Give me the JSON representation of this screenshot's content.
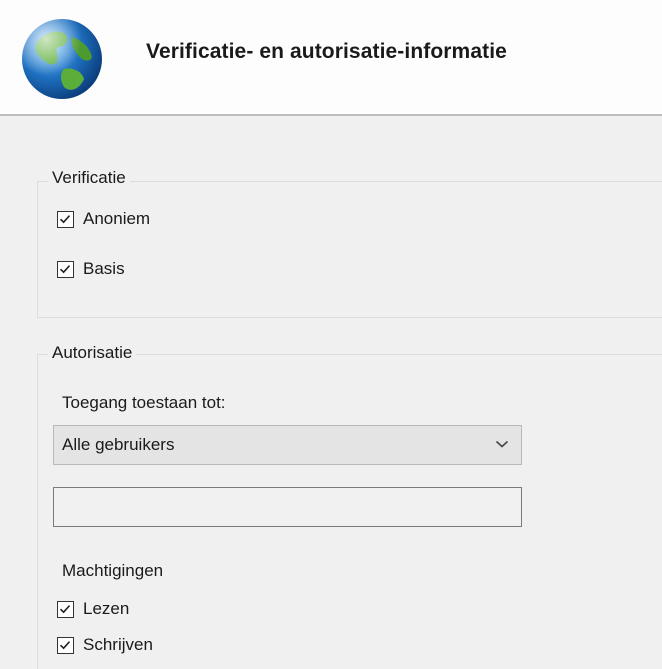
{
  "header": {
    "title": "Verificatie- en autorisatie-informatie",
    "icon": "globe-icon"
  },
  "verificatie": {
    "legend": "Verificatie",
    "options": [
      {
        "label": "Anoniem",
        "checked": true
      },
      {
        "label": "Basis",
        "checked": true
      }
    ]
  },
  "autorisatie": {
    "legend": "Autorisatie",
    "access_label": "Toegang toestaan tot:",
    "access_select": {
      "selected": "Alle gebruikers"
    },
    "access_input": {
      "value": ""
    },
    "permissions_label": "Machtigingen",
    "permissions": [
      {
        "label": "Lezen",
        "checked": true
      },
      {
        "label": "Schrijven",
        "checked": true
      }
    ]
  },
  "colors": {
    "background": "#f0f0f0",
    "header_background": "#fdfdfd",
    "globe_ocean": "#1e6fc0",
    "globe_land": "#5cae3a"
  }
}
